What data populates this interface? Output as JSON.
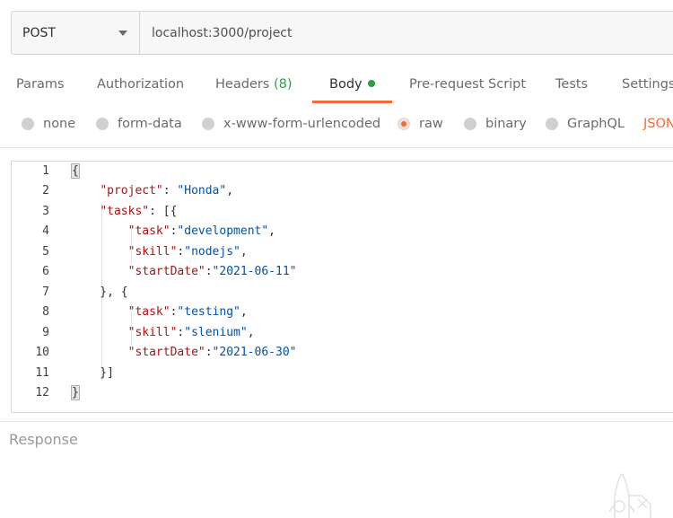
{
  "request": {
    "method": "POST",
    "url": "localhost:3000/project"
  },
  "tabs": [
    {
      "label": "Params"
    },
    {
      "label": "Authorization"
    },
    {
      "label": "Headers",
      "count": "(8)"
    },
    {
      "label": "Body",
      "active": true,
      "indicator": "green-dot-icon"
    },
    {
      "label": "Pre-request Script"
    },
    {
      "label": "Tests"
    },
    {
      "label": "Settings"
    }
  ],
  "body_modes": {
    "options": [
      "none",
      "form-data",
      "x-www-form-urlencoded",
      "raw",
      "binary",
      "GraphQL"
    ],
    "selected": "raw",
    "format_label": "JSON"
  },
  "editor": {
    "line_numbers": [
      "1",
      "2",
      "3",
      "4",
      "5",
      "6",
      "7",
      "8",
      "9",
      "10",
      "11",
      "12"
    ],
    "lines": [
      "{",
      "    \"project\": \"Honda\",",
      "    \"tasks\": [{",
      "        \"task\":\"development\",",
      "        \"skill\":\"nodejs\",",
      "        \"startDate\":\"2021-06-11\"",
      "    }, {",
      "        \"task\":\"testing\",",
      "        \"skill\":\"slenium\",",
      "        \"startDate\":\"2021-06-30\"",
      "    }]",
      "}"
    ]
  },
  "response": {
    "title": "Response"
  },
  "colors": {
    "accent": "#f26b3a",
    "success": "#27a044",
    "json_key": "#a31515",
    "json_string": "#0451a5"
  }
}
